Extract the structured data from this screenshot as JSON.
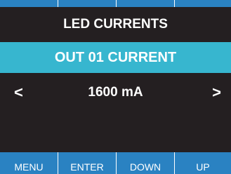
{
  "screen": {
    "title": "LED CURRENTS",
    "parameter": "OUT 01 CURRENT",
    "value": "1600 mA",
    "left_arrow": "<",
    "right_arrow": ">"
  },
  "softkeys": [
    "MENU",
    "ENTER",
    "DOWN",
    "UP"
  ],
  "colors": {
    "screen_background": "#241f21",
    "highlight_bar": "#37b6cf",
    "softkey_bar": "#2a82c2",
    "text": "#ffffff"
  }
}
